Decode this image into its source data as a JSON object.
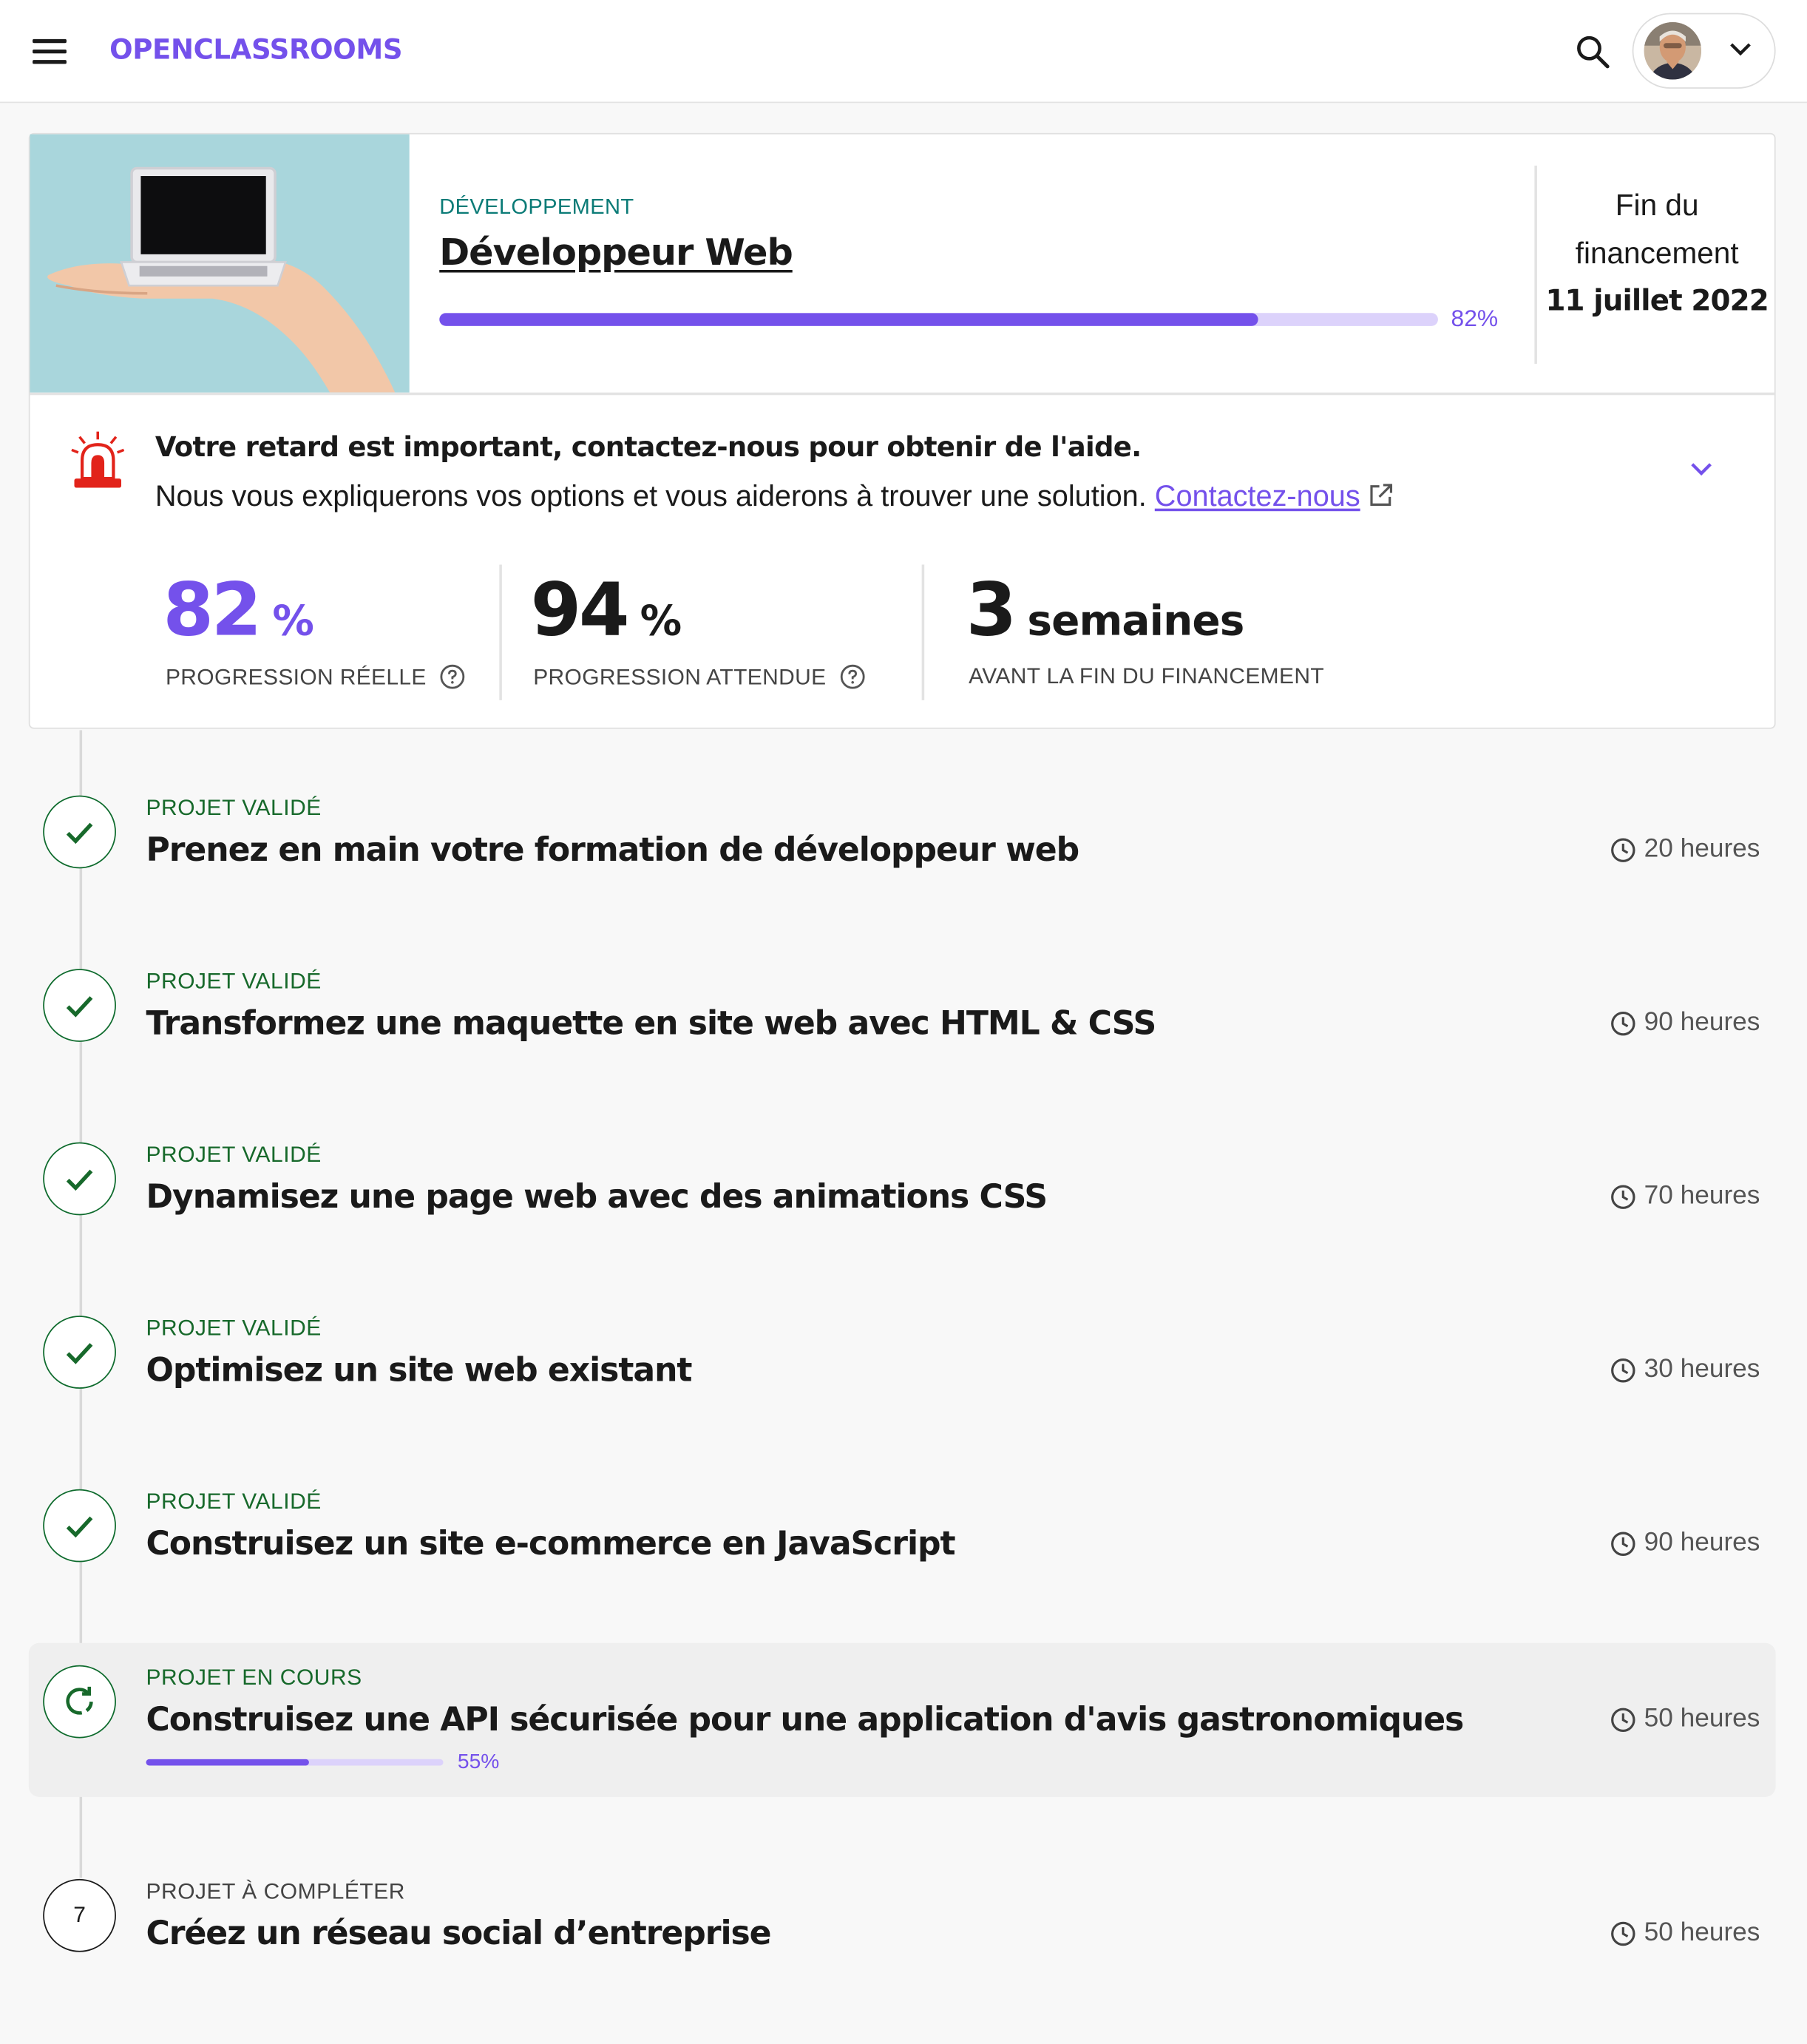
{
  "header": {
    "logo": "OPENCLASSROOMS",
    "menu_icon": "hamburger-menu-icon",
    "search_icon": "search-icon",
    "profile_chevron_icon": "chevron-down-icon"
  },
  "course": {
    "category": "DÉVELOPPEMENT",
    "title": "Développeur Web",
    "progress_percent": 82,
    "progress_label": "82%",
    "funding_label_line1": "Fin du",
    "funding_label_line2": "financement",
    "funding_date": "11 juillet 2022"
  },
  "alert": {
    "icon": "alarm-siren-icon",
    "title": "Votre retard est important, contactez-nous pour obtenir de l'aide.",
    "text": "Nous vous expliquerons vos options et vous aiderons à trouver une solution.",
    "link": "Contactez-nous"
  },
  "stats": [
    {
      "value": "82",
      "unit": "%",
      "label": "PROGRESSION RÉELLE",
      "color": "#7451eb"
    },
    {
      "value": "94",
      "unit": "%",
      "label": "PROGRESSION ATTENDUE",
      "color": "#1a1a1a"
    },
    {
      "value": "3",
      "unit": "semaines",
      "label": "AVANT LA FIN DU FINANCEMENT",
      "color": "#1a1a1a"
    }
  ],
  "projects": [
    {
      "status": "PROJET VALIDÉ",
      "title": "Prenez en main votre formation de développeur web",
      "duration": "20 heures",
      "state": "done"
    },
    {
      "status": "PROJET VALIDÉ",
      "title": "Transformez une maquette en site web avec HTML & CSS",
      "duration": "90 heures",
      "state": "done"
    },
    {
      "status": "PROJET VALIDÉ",
      "title": "Dynamisez une page web avec des animations CSS",
      "duration": "70 heures",
      "state": "done"
    },
    {
      "status": "PROJET VALIDÉ",
      "title": "Optimisez un site web existant",
      "duration": "30 heures",
      "state": "done"
    },
    {
      "status": "PROJET VALIDÉ",
      "title": "Construisez un site e-commerce en JavaScript",
      "duration": "90 heures",
      "state": "done"
    },
    {
      "status": "PROJET EN COURS",
      "title": "Construisez une API sécurisée pour une application d'avis gastronomiques",
      "duration": "50 heures",
      "state": "current",
      "progress_percent": 55,
      "progress_label": "55%"
    },
    {
      "status": "PROJET À COMPLÉTER",
      "title": "Créez un réseau social d’entreprise",
      "duration": "50 heures",
      "state": "todo",
      "number": "7"
    }
  ],
  "colors": {
    "accent": "#7451eb",
    "success": "#17692b",
    "category": "#0b7b77",
    "alert_red": "#e2231a"
  }
}
